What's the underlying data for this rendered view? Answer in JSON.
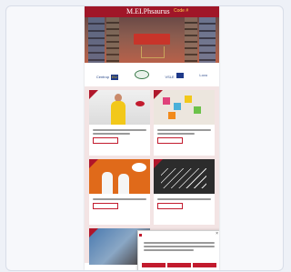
{
  "brand": {
    "name": "M.EI.Phsaurus",
    "tagline": "Code #"
  },
  "hero": {
    "title": ""
  },
  "partner_logos": [
    "Centrop",
    "",
    "VSLE",
    "Lovo"
  ],
  "eu_flag_label": "EU",
  "cards": [
    {
      "title": "",
      "button": ""
    },
    {
      "title": "",
      "button": ""
    },
    {
      "title": "",
      "button": ""
    },
    {
      "title": "",
      "button": ""
    }
  ],
  "cookie_banner": {
    "title": "",
    "close": "×",
    "buttons": [
      "",
      "",
      ""
    ]
  },
  "colors": {
    "brand_red": "#a01628",
    "accent_red": "#c21b2e",
    "section_bg": "#f3e4e4"
  }
}
